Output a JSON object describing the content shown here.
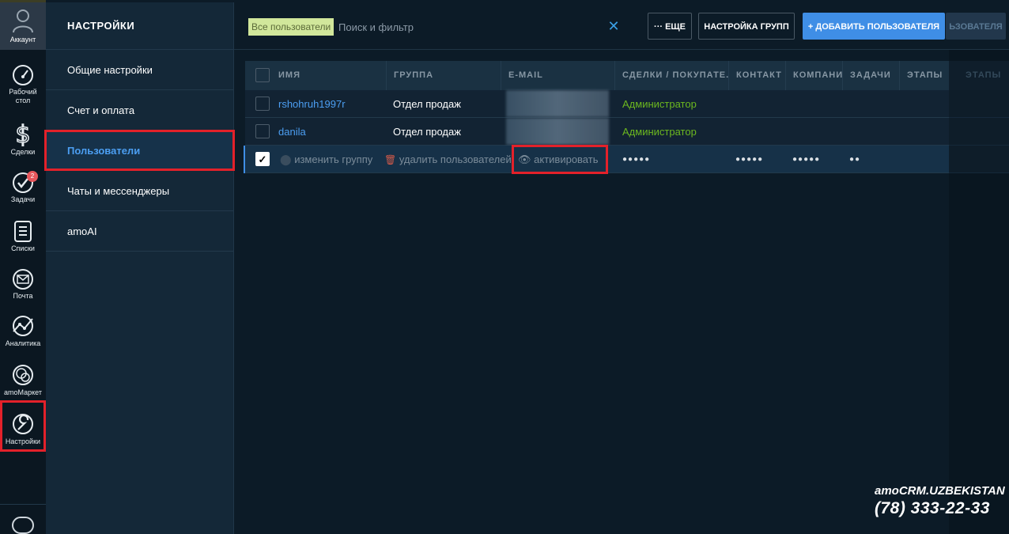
{
  "rail": {
    "account_label": "Аккаунт",
    "items": [
      {
        "label_line1": "Рабочий",
        "label_line2": "стол"
      },
      {
        "label_line1": "Сделки",
        "label_line2": ""
      },
      {
        "label_line1": "Задачи",
        "label_line2": "",
        "badge": "2"
      },
      {
        "label_line1": "Списки",
        "label_line2": ""
      },
      {
        "label_line1": "Почта",
        "label_line2": ""
      },
      {
        "label_line1": "Аналитика",
        "label_line2": ""
      },
      {
        "label_line1": "amoМаркет",
        "label_line2": ""
      },
      {
        "label_line1": "Настройки",
        "label_line2": ""
      }
    ]
  },
  "settings": {
    "title": "НАСТРОЙКИ",
    "items": [
      "Общие настройки",
      "Счет и оплата",
      "Пользователи",
      "Чаты и мессенджеры",
      "amoAI"
    ]
  },
  "topbar": {
    "filter_tag": "Все пользователи",
    "search_placeholder": "Поиск и фильтр",
    "clear": "✕",
    "more_label": "··· ЕЩЕ",
    "groups_label": "НАСТРОЙКА ГРУПП",
    "add_label": "+ ДОБАВИТЬ ПОЛЬЗОВАТЕЛЯ",
    "ghost_label": "ЬЗОВАТЕЛЯ"
  },
  "table": {
    "headers": [
      "ИМЯ",
      "ГРУППА",
      "E-MAIL",
      "СДЕЛКИ / ПОКУПАТЕ.",
      "КОНТАКТ",
      "КОМПАНИ",
      "ЗАДАЧИ",
      "ЭТАПЫ"
    ],
    "rows": [
      {
        "name": "rshohruh1997r",
        "group": "Отдел продаж",
        "role": "Администратор"
      },
      {
        "name": "danila",
        "group": "Отдел продаж",
        "role": "Администратор"
      }
    ],
    "selected_row": {
      "change_group": "изменить группу",
      "delete_users": "удалить пользователей",
      "activate": "активировать",
      "dots_deals": "●●●●●",
      "dots_contacts": "●●●●●",
      "dots_companies": "●●●●●",
      "dots_tasks": "●●"
    },
    "shade_header": "ЭТАПЫ"
  },
  "brand": {
    "logo": "amoCRM.UZBEKISTAN",
    "phone": "(78) 333-22-33"
  },
  "colors": {
    "accent": "#3f8ee6",
    "link": "#4c9ff3",
    "role": "#6cb81f",
    "highlight": "#e3212a"
  }
}
